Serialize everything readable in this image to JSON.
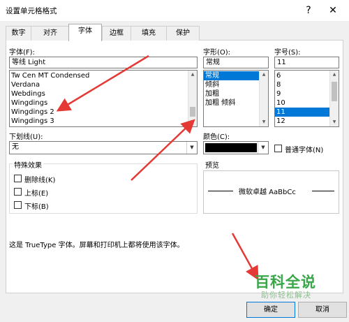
{
  "window": {
    "title": "设置单元格格式",
    "help_glyph": "?",
    "close_glyph": "✕"
  },
  "tabs": [
    {
      "label": "数字"
    },
    {
      "label": "对齐"
    },
    {
      "label": "字体"
    },
    {
      "label": "边框"
    },
    {
      "label": "填充"
    },
    {
      "label": "保护"
    }
  ],
  "font": {
    "label": "字体(F):",
    "value": "等线 Light",
    "options": [
      "Tw Cen MT Condensed",
      "Verdana",
      "Webdings",
      "Wingdings",
      "Wingdings 2",
      "Wingdings 3"
    ]
  },
  "style": {
    "label": "字形(O):",
    "value": "常规",
    "options": [
      "常规",
      "倾斜",
      "加粗",
      "加粗 倾斜"
    ],
    "selected": "常规"
  },
  "size": {
    "label": "字号(S):",
    "value": "11",
    "options": [
      "6",
      "8",
      "9",
      "10",
      "11",
      "12"
    ],
    "selected": "11"
  },
  "underline": {
    "label": "下划线(U):",
    "value": "无"
  },
  "color": {
    "label": "颜色(C):",
    "swatch": "#000000"
  },
  "normal_font": {
    "label": "普通字体(N)",
    "checked": false
  },
  "effects": {
    "label": "特殊效果",
    "strikethrough": "删除线(K)",
    "superscript": "上标(E)",
    "subscript": "下标(B)"
  },
  "preview": {
    "label": "预览",
    "sample": "微软卓越  AaBbCc"
  },
  "info_text": "这是 TrueType 字体。屏幕和打印机上都将使用该字体。",
  "buttons": {
    "ok": "确定",
    "cancel": "取消"
  },
  "watermark": {
    "main": "百科全说",
    "sub": "助你轻松解决"
  },
  "colors": {
    "selection": "#0078d7",
    "annotation_arrow": "#e53935",
    "watermark": "#3aa64a"
  }
}
